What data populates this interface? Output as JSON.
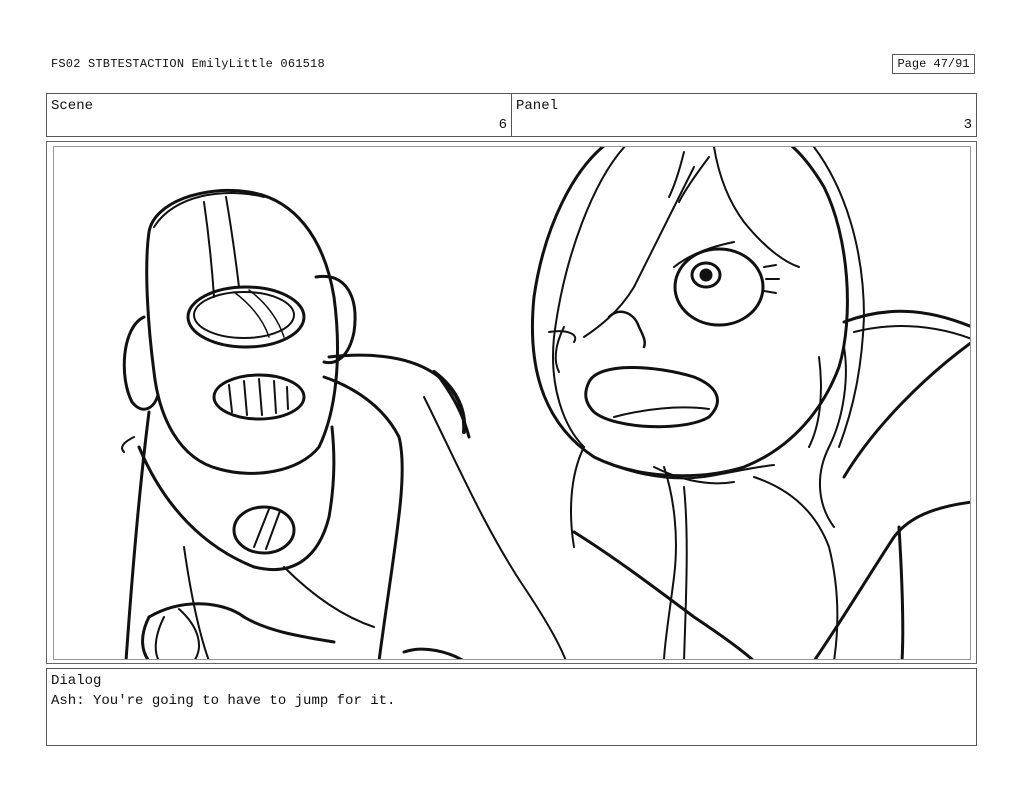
{
  "header": {
    "title": "FS02 STBTESTACTION EmilyLittle 061518",
    "page": "Page 47/91"
  },
  "info": {
    "scene_label": "Scene",
    "scene_value": "6",
    "panel_label": "Panel",
    "panel_value": "3"
  },
  "dialog": {
    "label": "Dialog",
    "text": "Ash: You're going to have to jump for it."
  }
}
